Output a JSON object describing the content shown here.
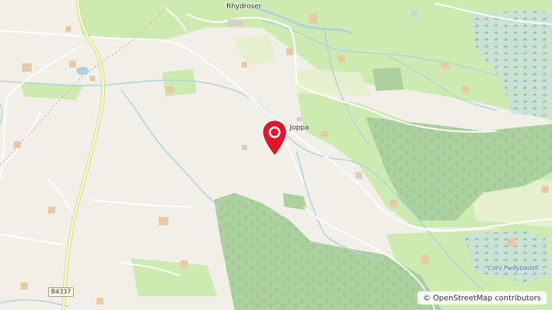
{
  "map": {
    "attribution": "© OpenStreetMap contributors",
    "places": {
      "rhydroser": "Rhydroser",
      "joppa": "Joppa",
      "cors_pwllybadell": "Cors Pwllybadell"
    },
    "road_refs": {
      "b4337": "B4337"
    },
    "marker": {
      "icon": "map-pin-icon",
      "color": "#e5142a"
    },
    "colors": {
      "land": "#f2efe9",
      "farmland": "#e6f0cf",
      "meadow": "#cdebb0",
      "forest": "#add19e",
      "wetland": "#c8dde8",
      "water": "#aad3df",
      "primary_road": "#f7fabf",
      "building": "#e8c9a1"
    }
  }
}
